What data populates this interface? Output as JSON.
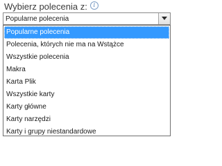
{
  "chooser": {
    "label": "Wybierz polecenia z:",
    "info_icon": "info-circle-icon",
    "selected_value": "Popularne polecenia"
  },
  "options": [
    {
      "label": "Popularne polecenia",
      "selected": true
    },
    {
      "label": "Polecenia, których nie ma na Wstążce",
      "selected": false
    },
    {
      "label": "Wszystkie polecenia",
      "selected": false
    },
    {
      "label": "Makra",
      "selected": false
    },
    {
      "label": "Karta Plik",
      "selected": false
    },
    {
      "label": "Wszystkie karty",
      "selected": false
    },
    {
      "label": "Karty główne",
      "selected": false
    },
    {
      "label": "Karty narzędzi",
      "selected": false
    },
    {
      "label": "Karty i grupy niestandardowe",
      "selected": false
    }
  ],
  "colors": {
    "selection": "#3399ff",
    "text": "#1a1a1a",
    "label_text": "#3b3b3b"
  }
}
